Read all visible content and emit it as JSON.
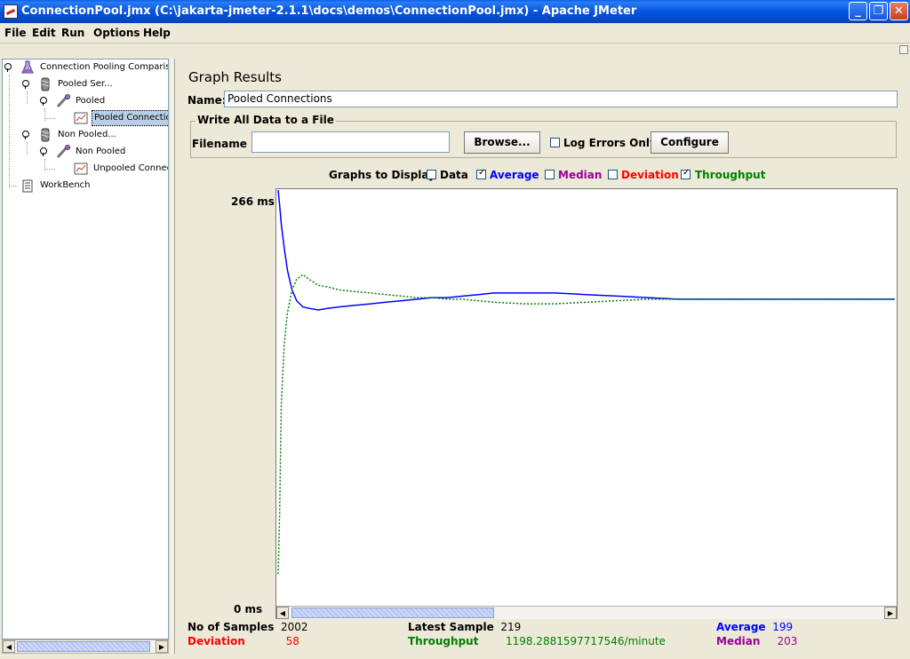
{
  "window": {
    "title": "ConnectionPool.jmx (C:\\jakarta-jmeter-2.1.1\\docs\\demos\\ConnectionPool.jmx) - Apache JMeter",
    "min_label": "_",
    "max_label": "❐",
    "close_label": "✕"
  },
  "menu": [
    {
      "label": "File"
    },
    {
      "label": "Edit"
    },
    {
      "label": "Run"
    },
    {
      "label": "Options"
    },
    {
      "label": "Help"
    }
  ],
  "tree": {
    "nodes": [
      {
        "label": "Connection Pooling Comparison",
        "icon": "flask-icon"
      },
      {
        "label": "Pooled Ser...",
        "icon": "thread-group-icon"
      },
      {
        "label": "Pooled",
        "icon": "sampler-icon"
      },
      {
        "label": "Pooled Connections",
        "icon": "graph-icon",
        "selected": true
      },
      {
        "label": "Non Pooled...",
        "icon": "thread-group-icon"
      },
      {
        "label": "Non Pooled",
        "icon": "sampler-icon"
      },
      {
        "label": "Unpooled Connections",
        "icon": "graph-icon"
      },
      {
        "label": "WorkBench",
        "icon": "workbench-icon"
      }
    ]
  },
  "panel": {
    "title": "Graph Results",
    "name_label": "Name:",
    "name_value": "Pooled Connections",
    "file_group_label": "Write All Data to a File",
    "filename_label": "Filename",
    "filename_value": "",
    "browse_label": "Browse...",
    "log_errors_label": "Log Errors Only",
    "log_errors_checked": false,
    "configure_label": "Configure",
    "graphs_to_display_label": "Graphs to Display",
    "graph_toggles": [
      {
        "label": "Data",
        "checked": false,
        "color": "#000000"
      },
      {
        "label": "Average",
        "checked": true,
        "color": "#0000ff"
      },
      {
        "label": "Median",
        "checked": false,
        "color": "#990099"
      },
      {
        "label": "Deviation",
        "checked": false,
        "color": "#ff0000"
      },
      {
        "label": "Throughput",
        "checked": true,
        "color": "#008000"
      }
    ]
  },
  "chart_data": {
    "type": "line",
    "ylabel_top": "266 ms",
    "ylabel_bottom": "0 ms",
    "ylim": [
      0,
      266
    ],
    "x_samples": [
      0,
      5,
      10,
      20,
      30,
      45,
      60,
      80,
      100,
      130,
      160,
      200,
      250,
      300,
      350,
      400,
      450,
      500,
      550,
      600,
      650,
      700,
      800,
      900,
      1000,
      1100,
      1200,
      1300,
      1400,
      1500,
      1600,
      1700,
      1800,
      1900,
      2002
    ],
    "series": [
      {
        "name": "Average",
        "color": "#0000ff",
        "values": [
          270,
          260,
          248,
          232,
          218,
          205,
          198,
          194,
          193,
          192,
          193,
          194,
          195,
          196,
          197,
          198,
          199,
          200,
          200,
          201,
          202,
          203,
          203,
          203,
          202,
          201,
          200,
          199,
          199,
          199,
          199,
          199,
          199,
          199,
          199
        ]
      },
      {
        "name": "Throughput",
        "color": "#008000",
        "values": [
          20,
          60,
          130,
          170,
          190,
          205,
          212,
          215,
          212,
          208,
          207,
          205,
          204,
          203,
          202,
          201,
          200,
          200,
          199,
          199,
          198,
          197,
          196,
          196,
          197,
          198,
          199,
          199,
          199,
          199,
          199,
          199,
          199,
          199,
          199
        ]
      }
    ]
  },
  "stats": {
    "samples_label": "No of Samples",
    "samples_value": "2002",
    "latest_label": "Latest Sample",
    "latest_value": "219",
    "average_label": "Average",
    "average_value": "199",
    "deviation_label": "Deviation",
    "deviation_value": "58",
    "throughput_label": "Throughput",
    "throughput_value": "1198.2881597717546/minute",
    "median_label": "Median",
    "median_value": "203"
  }
}
